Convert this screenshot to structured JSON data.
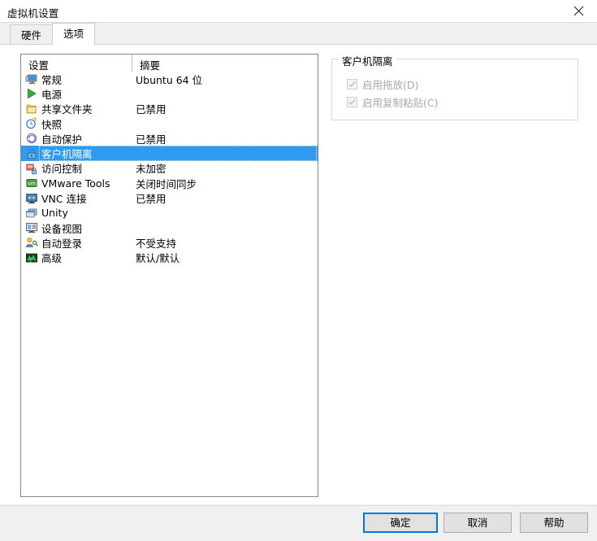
{
  "window": {
    "title": "虚拟机设置",
    "close_icon": "close-icon"
  },
  "tabs": [
    {
      "label": "硬件",
      "active": false
    },
    {
      "label": "选项",
      "active": true
    }
  ],
  "list": {
    "headers": {
      "setting": "设置",
      "summary": "摘要"
    },
    "rows": [
      {
        "icon": "monitor-general-icon",
        "label": "常规",
        "summary": "Ubuntu 64 位",
        "selected": false
      },
      {
        "icon": "power-play-icon",
        "label": "电源",
        "summary": "",
        "selected": false
      },
      {
        "icon": "shared-folder-icon",
        "label": "共享文件夹",
        "summary": "已禁用",
        "selected": false
      },
      {
        "icon": "snapshot-clock-icon",
        "label": "快照",
        "summary": "",
        "selected": false
      },
      {
        "icon": "autoprotect-icon",
        "label": "自动保护",
        "summary": "已禁用",
        "selected": false
      },
      {
        "icon": "lock-isolation-icon",
        "label": "客户机隔离",
        "summary": "",
        "selected": true
      },
      {
        "icon": "access-control-icon",
        "label": "访问控制",
        "summary": "未加密",
        "selected": false
      },
      {
        "icon": "vmware-tools-icon",
        "label": "VMware Tools",
        "summary": "关闭时间同步",
        "selected": false
      },
      {
        "icon": "vnc-connection-icon",
        "label": "VNC 连接",
        "summary": "已禁用",
        "selected": false
      },
      {
        "icon": "unity-icon",
        "label": "Unity",
        "summary": "",
        "selected": false
      },
      {
        "icon": "device-view-icon",
        "label": "设备视图",
        "summary": "",
        "selected": false
      },
      {
        "icon": "auto-login-icon",
        "label": "自动登录",
        "summary": "不受支持",
        "selected": false
      },
      {
        "icon": "advanced-icon",
        "label": "高级",
        "summary": "默认/默认",
        "selected": false
      }
    ]
  },
  "right_panel": {
    "group_title": "客户机隔离",
    "checkboxes": [
      {
        "label": "启用拖放(D)",
        "checked": true,
        "disabled": true
      },
      {
        "label": "启用复制粘贴(C)",
        "checked": true,
        "disabled": true
      }
    ]
  },
  "footer": {
    "ok": "确定",
    "cancel": "取消",
    "help": "帮助"
  },
  "colors": {
    "selection_blue": "#2e9bf0",
    "default_button_border": "#0078d7",
    "window_background": "#f0f0f0",
    "panel_background": "#ffffff"
  }
}
